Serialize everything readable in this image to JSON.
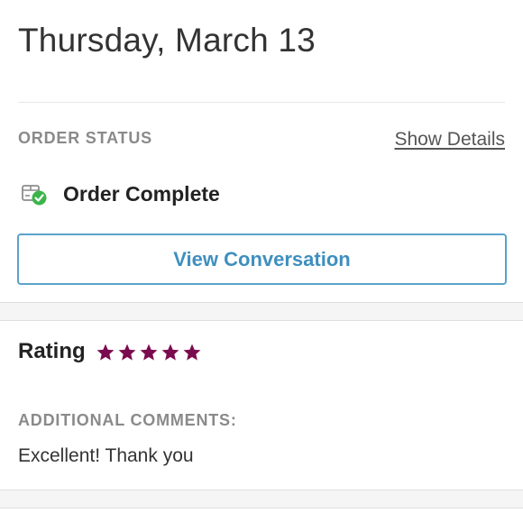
{
  "header": {
    "date": "Thursday, March 13"
  },
  "order": {
    "status_label": "ORDER STATUS",
    "show_details_label": "Show Details",
    "status_text": "Order Complete",
    "status_icon": "package-check-icon",
    "view_conversation_label": "View Conversation"
  },
  "rating": {
    "label": "Rating",
    "stars": 5,
    "max_stars": 5,
    "star_color": "#7a0b4e"
  },
  "comments": {
    "label": "ADDITIONAL COMMENTS:",
    "text": "Excellent! Thank you"
  },
  "colors": {
    "accent": "#3f8fbf",
    "check_green": "#3bb54a"
  }
}
